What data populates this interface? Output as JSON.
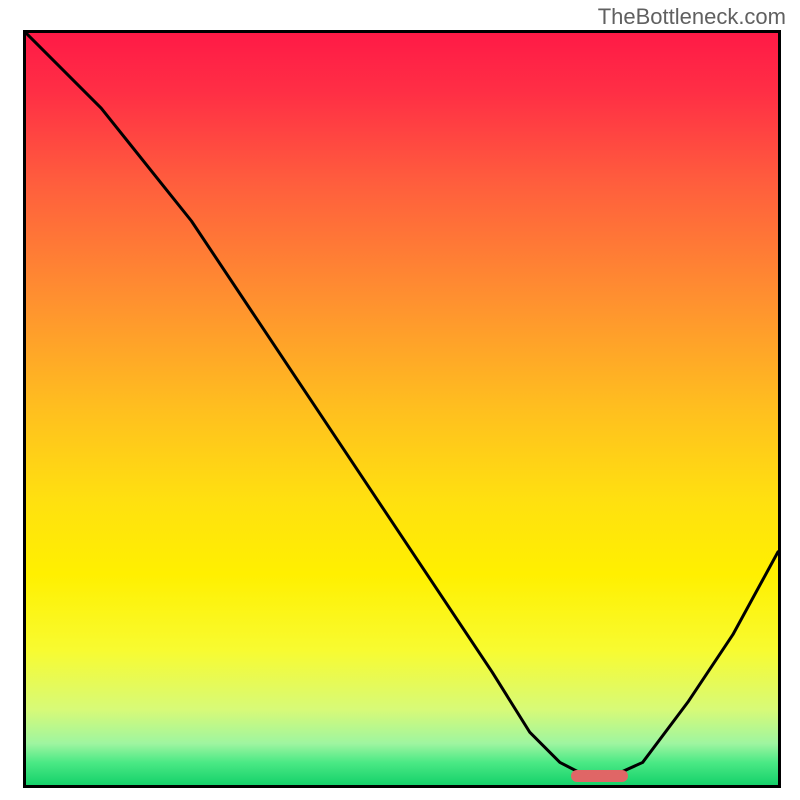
{
  "watermark": "TheBottleneck.com",
  "chart_data": {
    "type": "line",
    "title": "",
    "xlabel": "",
    "ylabel": "",
    "xlim": [
      0,
      100
    ],
    "ylim": [
      0,
      100
    ],
    "background": {
      "type": "vertical-gradient",
      "stops": [
        {
          "pos": 0.0,
          "color": "#ff1a46"
        },
        {
          "pos": 0.08,
          "color": "#ff2f45"
        },
        {
          "pos": 0.2,
          "color": "#ff5e3d"
        },
        {
          "pos": 0.35,
          "color": "#ff8f30"
        },
        {
          "pos": 0.5,
          "color": "#ffbf1f"
        },
        {
          "pos": 0.62,
          "color": "#ffe010"
        },
        {
          "pos": 0.72,
          "color": "#fff000"
        },
        {
          "pos": 0.82,
          "color": "#f8fb30"
        },
        {
          "pos": 0.9,
          "color": "#d7fa78"
        },
        {
          "pos": 0.945,
          "color": "#9ef5a0"
        },
        {
          "pos": 0.97,
          "color": "#4be985"
        },
        {
          "pos": 1.0,
          "color": "#15d16a"
        }
      ]
    },
    "series": [
      {
        "name": "bottleneck-curve",
        "stroke": "#000000",
        "stroke_width": 3,
        "x": [
          0,
          4,
          10,
          18,
          22,
          30,
          38,
          46,
          54,
          62,
          67,
          71,
          74.5,
          78,
          82,
          88,
          94,
          100
        ],
        "y": [
          100,
          96,
          90,
          80,
          75,
          63,
          51,
          39,
          27,
          15,
          7,
          3,
          1.2,
          1.2,
          3,
          11,
          20,
          31
        ]
      }
    ],
    "marker": {
      "name": "optimal-range",
      "color": "#e06666",
      "x_start": 72.5,
      "x_end": 80,
      "y": 1.2,
      "height_pct": 1.7
    }
  }
}
